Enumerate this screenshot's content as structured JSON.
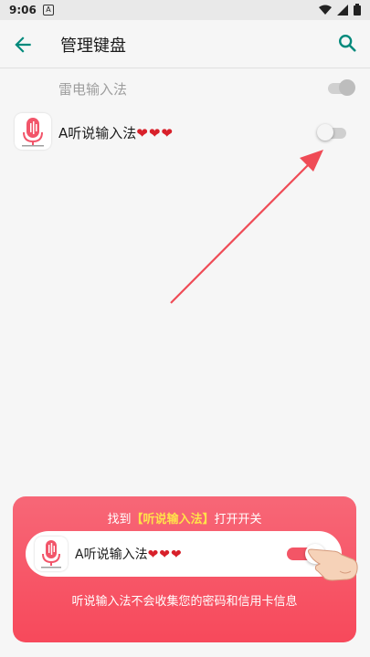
{
  "status_bar": {
    "time": "9:06",
    "notification_letter": "A"
  },
  "app_bar": {
    "title": "管理键盘"
  },
  "keyboards": [
    {
      "name": "雷电输入法",
      "enabled": true,
      "disabled_row": true
    },
    {
      "name_prefix": "A听说输入法",
      "hearts": "❤❤❤",
      "enabled": false
    }
  ],
  "guide": {
    "title_before": "找到",
    "title_highlight": "【听说输入法】",
    "title_after": "打开开关",
    "demo_prefix": "A听说输入法",
    "demo_hearts": "❤❤❤",
    "footer": "听说输入法不会收集您的密码和信用卡信息"
  },
  "colors": {
    "accent": "#00897b",
    "guide_gradient_top": "#f76777",
    "guide_gradient_bottom": "#f7495b",
    "highlight": "#ffe24a",
    "arrow": "#ef4b56"
  }
}
